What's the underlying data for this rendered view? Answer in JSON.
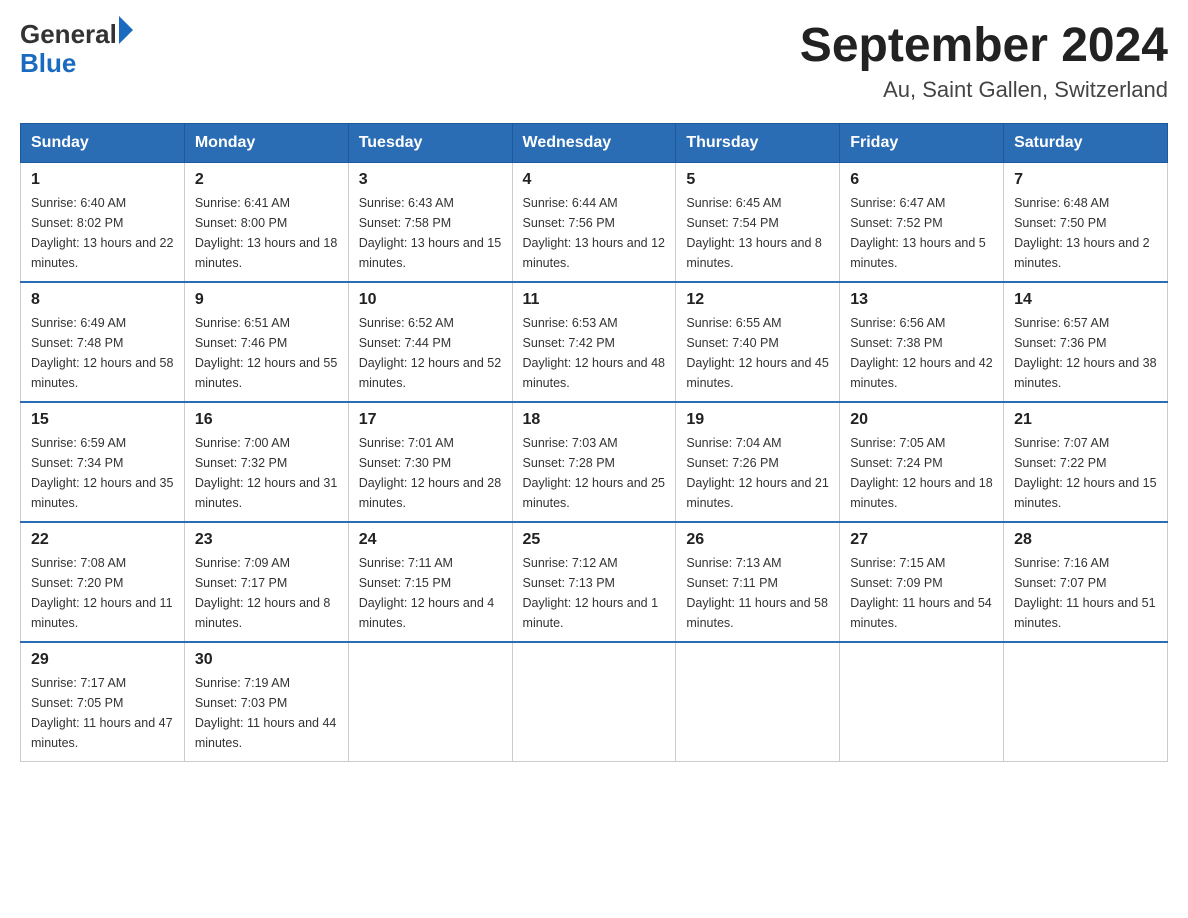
{
  "header": {
    "logo": {
      "general": "General",
      "blue": "Blue"
    },
    "title": "September 2024",
    "location": "Au, Saint Gallen, Switzerland"
  },
  "weekdays": [
    "Sunday",
    "Monday",
    "Tuesday",
    "Wednesday",
    "Thursday",
    "Friday",
    "Saturday"
  ],
  "weeks": [
    [
      {
        "day": "1",
        "sunrise": "6:40 AM",
        "sunset": "8:02 PM",
        "daylight": "13 hours and 22 minutes."
      },
      {
        "day": "2",
        "sunrise": "6:41 AM",
        "sunset": "8:00 PM",
        "daylight": "13 hours and 18 minutes."
      },
      {
        "day": "3",
        "sunrise": "6:43 AM",
        "sunset": "7:58 PM",
        "daylight": "13 hours and 15 minutes."
      },
      {
        "day": "4",
        "sunrise": "6:44 AM",
        "sunset": "7:56 PM",
        "daylight": "13 hours and 12 minutes."
      },
      {
        "day": "5",
        "sunrise": "6:45 AM",
        "sunset": "7:54 PM",
        "daylight": "13 hours and 8 minutes."
      },
      {
        "day": "6",
        "sunrise": "6:47 AM",
        "sunset": "7:52 PM",
        "daylight": "13 hours and 5 minutes."
      },
      {
        "day": "7",
        "sunrise": "6:48 AM",
        "sunset": "7:50 PM",
        "daylight": "13 hours and 2 minutes."
      }
    ],
    [
      {
        "day": "8",
        "sunrise": "6:49 AM",
        "sunset": "7:48 PM",
        "daylight": "12 hours and 58 minutes."
      },
      {
        "day": "9",
        "sunrise": "6:51 AM",
        "sunset": "7:46 PM",
        "daylight": "12 hours and 55 minutes."
      },
      {
        "day": "10",
        "sunrise": "6:52 AM",
        "sunset": "7:44 PM",
        "daylight": "12 hours and 52 minutes."
      },
      {
        "day": "11",
        "sunrise": "6:53 AM",
        "sunset": "7:42 PM",
        "daylight": "12 hours and 48 minutes."
      },
      {
        "day": "12",
        "sunrise": "6:55 AM",
        "sunset": "7:40 PM",
        "daylight": "12 hours and 45 minutes."
      },
      {
        "day": "13",
        "sunrise": "6:56 AM",
        "sunset": "7:38 PM",
        "daylight": "12 hours and 42 minutes."
      },
      {
        "day": "14",
        "sunrise": "6:57 AM",
        "sunset": "7:36 PM",
        "daylight": "12 hours and 38 minutes."
      }
    ],
    [
      {
        "day": "15",
        "sunrise": "6:59 AM",
        "sunset": "7:34 PM",
        "daylight": "12 hours and 35 minutes."
      },
      {
        "day": "16",
        "sunrise": "7:00 AM",
        "sunset": "7:32 PM",
        "daylight": "12 hours and 31 minutes."
      },
      {
        "day": "17",
        "sunrise": "7:01 AM",
        "sunset": "7:30 PM",
        "daylight": "12 hours and 28 minutes."
      },
      {
        "day": "18",
        "sunrise": "7:03 AM",
        "sunset": "7:28 PM",
        "daylight": "12 hours and 25 minutes."
      },
      {
        "day": "19",
        "sunrise": "7:04 AM",
        "sunset": "7:26 PM",
        "daylight": "12 hours and 21 minutes."
      },
      {
        "day": "20",
        "sunrise": "7:05 AM",
        "sunset": "7:24 PM",
        "daylight": "12 hours and 18 minutes."
      },
      {
        "day": "21",
        "sunrise": "7:07 AM",
        "sunset": "7:22 PM",
        "daylight": "12 hours and 15 minutes."
      }
    ],
    [
      {
        "day": "22",
        "sunrise": "7:08 AM",
        "sunset": "7:20 PM",
        "daylight": "12 hours and 11 minutes."
      },
      {
        "day": "23",
        "sunrise": "7:09 AM",
        "sunset": "7:17 PM",
        "daylight": "12 hours and 8 minutes."
      },
      {
        "day": "24",
        "sunrise": "7:11 AM",
        "sunset": "7:15 PM",
        "daylight": "12 hours and 4 minutes."
      },
      {
        "day": "25",
        "sunrise": "7:12 AM",
        "sunset": "7:13 PM",
        "daylight": "12 hours and 1 minute."
      },
      {
        "day": "26",
        "sunrise": "7:13 AM",
        "sunset": "7:11 PM",
        "daylight": "11 hours and 58 minutes."
      },
      {
        "day": "27",
        "sunrise": "7:15 AM",
        "sunset": "7:09 PM",
        "daylight": "11 hours and 54 minutes."
      },
      {
        "day": "28",
        "sunrise": "7:16 AM",
        "sunset": "7:07 PM",
        "daylight": "11 hours and 51 minutes."
      }
    ],
    [
      {
        "day": "29",
        "sunrise": "7:17 AM",
        "sunset": "7:05 PM",
        "daylight": "11 hours and 47 minutes."
      },
      {
        "day": "30",
        "sunrise": "7:19 AM",
        "sunset": "7:03 PM",
        "daylight": "11 hours and 44 minutes."
      },
      null,
      null,
      null,
      null,
      null
    ]
  ]
}
